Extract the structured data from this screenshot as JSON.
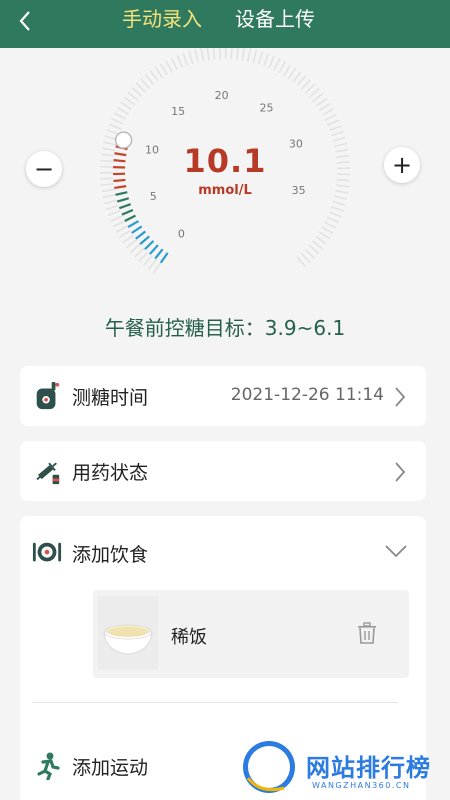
{
  "header": {
    "tabs": [
      {
        "label": "手动录入",
        "active": true
      },
      {
        "label": "设备上传",
        "active": false
      }
    ],
    "background_color": "#2f7a5f",
    "active_color": "#f4e27a"
  },
  "gauge": {
    "value": "10.1",
    "unit": "mmol/L",
    "ticks": [
      "0",
      "5",
      "10",
      "15",
      "20",
      "25",
      "30",
      "35"
    ],
    "min": 0,
    "max": 40,
    "value_color": "#b63a25"
  },
  "target": {
    "text": "午餐前控糖目标：3.9~6.1"
  },
  "rows": {
    "measure_time": {
      "label": "测糖时间",
      "value": "2021-12-26 11:14",
      "icon": "glucose-meter-icon"
    },
    "medication": {
      "label": "用药状态",
      "icon": "syringe-pill-icon"
    },
    "diet": {
      "label": "添加饮食",
      "icon": "plate-icon",
      "expanded": true
    },
    "exercise": {
      "label": "添加运动",
      "icon": "runner-icon"
    }
  },
  "food_items": [
    {
      "name": "稀饭"
    }
  ],
  "watermark": {
    "logo_text": "360",
    "text": "网站排行榜",
    "sub": "WANGZHAN360.CN"
  }
}
